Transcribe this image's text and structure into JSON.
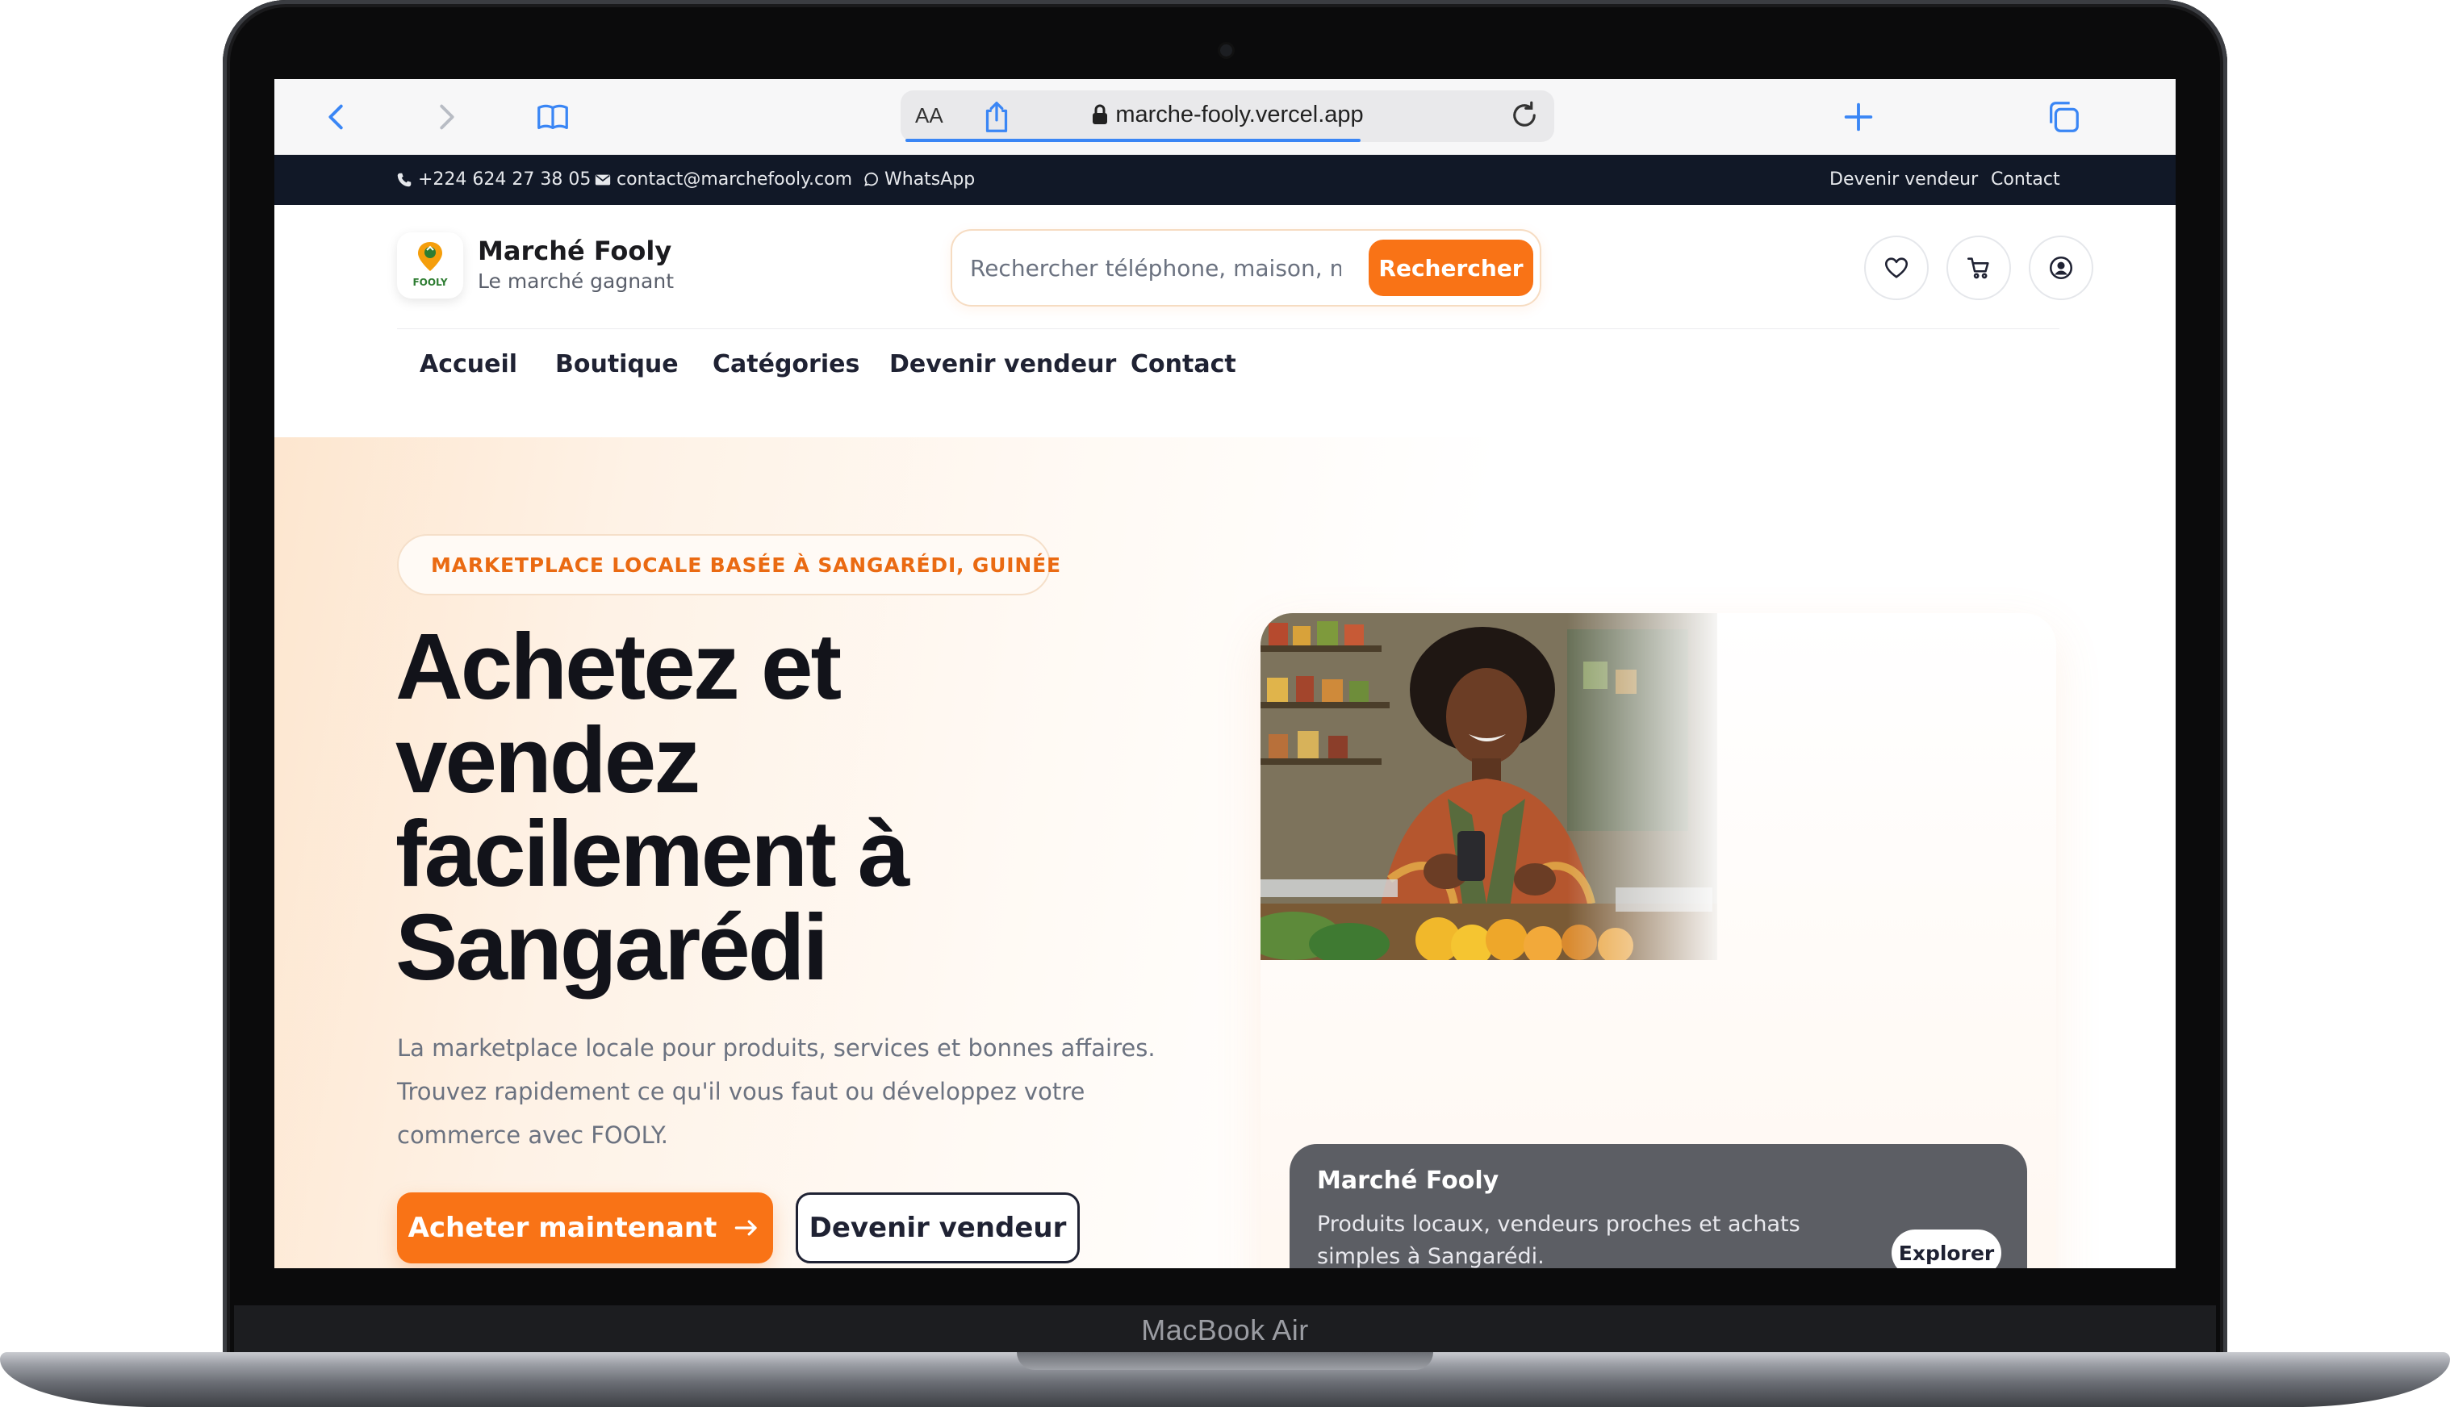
{
  "device": {
    "label": "MacBook Air"
  },
  "browser": {
    "text_size_label": "AA",
    "url": "marche-fooly.vercel.app",
    "page_load_progress": 0.7
  },
  "topbar": {
    "phone": "+224 624 27 38 05",
    "email": "contact@marchefooly.com",
    "whatsapp": "WhatsApp",
    "links": [
      "Devenir vendeur",
      "Contact"
    ]
  },
  "header": {
    "logo_text": "FOOLY",
    "brand_name": "Marché Fooly",
    "tagline": "Le marché gagnant",
    "search_placeholder": "Rechercher téléphone, maison, m",
    "search_button": "Rechercher"
  },
  "nav": {
    "items": [
      "Accueil",
      "Boutique",
      "Catégories",
      "Devenir vendeur",
      "Contact"
    ]
  },
  "hero": {
    "badge": "MARKETPLACE LOCALE BASÉE À SANGARÉDI, GUINÉE",
    "title_lines": [
      "Achetez et",
      "vendez",
      "facilement à",
      "Sangarédi"
    ],
    "description": "La marketplace locale pour produits, services et bonnes affaires. Trouvez rapidement ce qu'il vous faut ou développez votre commerce avec FOOLY.",
    "primary_cta": "Acheter maintenant",
    "secondary_cta": "Devenir vendeur"
  },
  "hero_card": {
    "title": "Marché Fooly",
    "text": "Produits locaux, vendeurs proches et achats simples à Sangarédi.",
    "button": "Explorer"
  },
  "colors": {
    "accent": "#f97316",
    "topbar_bg": "#111827",
    "heading": "#12131a",
    "safari_blue": "#3a86f5"
  }
}
